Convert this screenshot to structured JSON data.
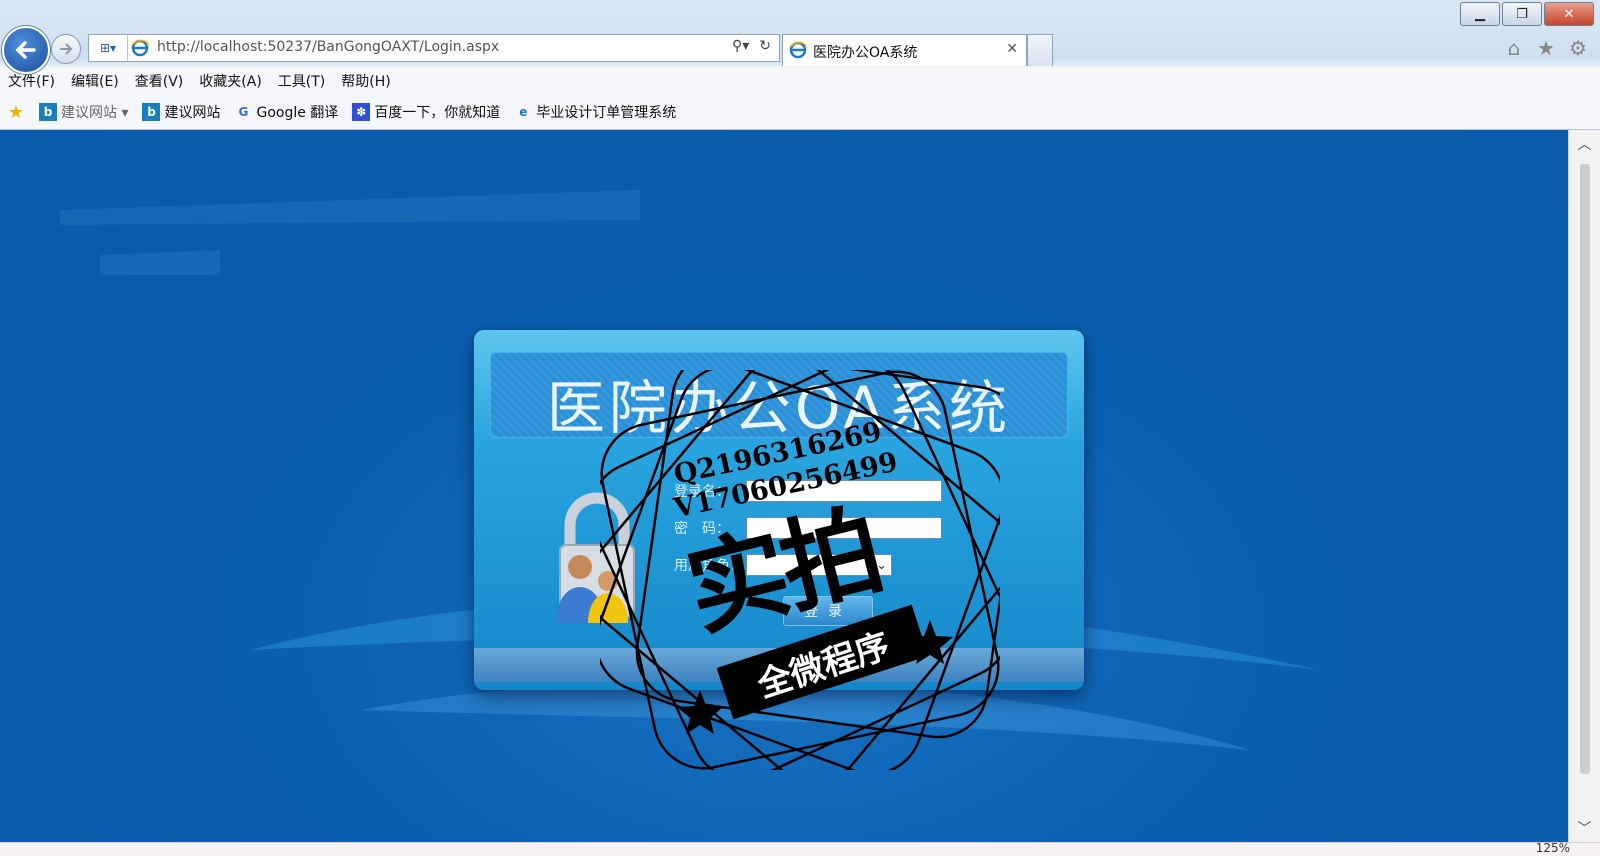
{
  "browser": {
    "address_url": "http://localhost:50237/BanGongOAXT/Login.aspx",
    "tab_title": "医院办公OA系统",
    "menu": [
      "文件(F)",
      "编辑(E)",
      "查看(V)",
      "收藏夹(A)",
      "工具(T)",
      "帮助(H)"
    ],
    "favorites": [
      {
        "label": "建议网站 ▾",
        "icon": "bing-icon"
      },
      {
        "label": "建议网站",
        "icon": "bing-icon"
      },
      {
        "label": "Google 翻译",
        "icon": "google-translate-icon"
      },
      {
        "label": "百度一下，你就知道",
        "icon": "baidu-paw-icon"
      },
      {
        "label": "毕业设计订单管理系统",
        "icon": "ie-page-icon"
      }
    ],
    "zoom": "125%"
  },
  "login": {
    "title": "医院办公OA系统",
    "username_label": "登录名：",
    "password_label": "密　码：",
    "role_label": "用户角色：",
    "role_selected": "",
    "login_button": "登录"
  },
  "watermark": {
    "line1": "Q2196316269",
    "line2": "V17060256499",
    "big_text": "实拍",
    "ribbon_text": "全微程序"
  }
}
